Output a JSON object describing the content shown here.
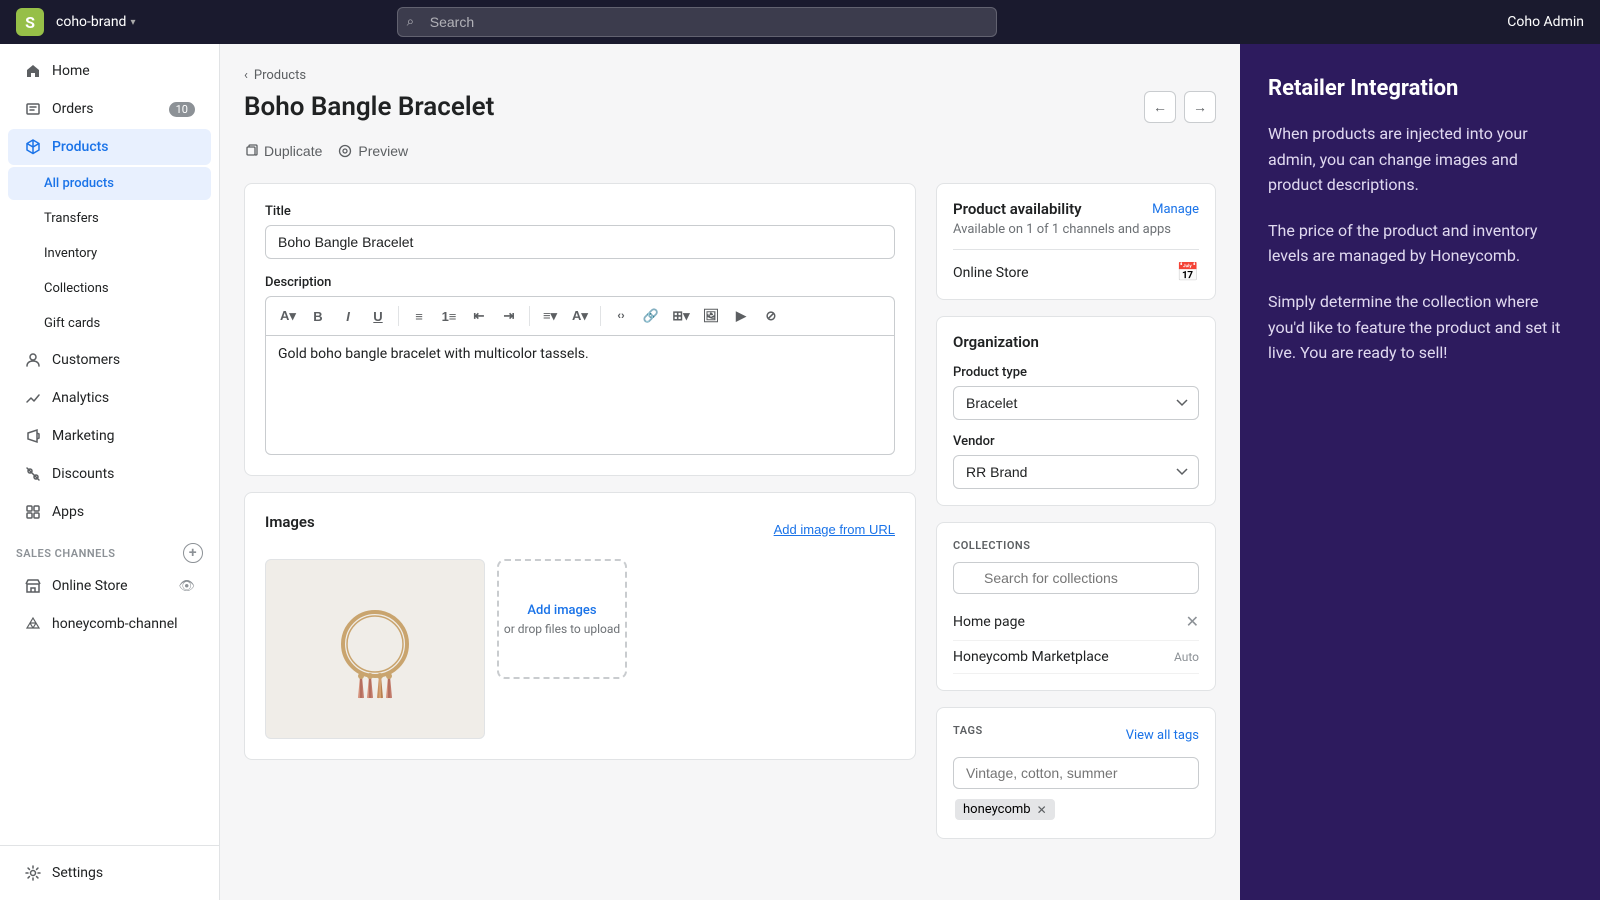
{
  "topnav": {
    "brand": "coho-brand",
    "caret": "▾",
    "search_placeholder": "Search",
    "admin_label": "Coho Admin"
  },
  "sidebar": {
    "items": [
      {
        "id": "home",
        "label": "Home",
        "icon": "home"
      },
      {
        "id": "orders",
        "label": "Orders",
        "icon": "orders",
        "badge": "10"
      },
      {
        "id": "products",
        "label": "Products",
        "icon": "products",
        "active": true
      },
      {
        "id": "all-products",
        "label": "All products",
        "sub": true,
        "active": true
      },
      {
        "id": "transfers",
        "label": "Transfers",
        "sub": true
      },
      {
        "id": "inventory",
        "label": "Inventory",
        "sub": true
      },
      {
        "id": "collections",
        "label": "Collections",
        "sub": true
      },
      {
        "id": "gift-cards",
        "label": "Gift cards",
        "sub": true
      },
      {
        "id": "customers",
        "label": "Customers",
        "icon": "customers"
      },
      {
        "id": "analytics",
        "label": "Analytics",
        "icon": "analytics"
      },
      {
        "id": "marketing",
        "label": "Marketing",
        "icon": "marketing"
      },
      {
        "id": "discounts",
        "label": "Discounts",
        "icon": "discounts"
      },
      {
        "id": "apps",
        "label": "Apps",
        "icon": "apps"
      }
    ],
    "sales_channels_label": "SALES CHANNELS",
    "channels": [
      {
        "id": "online-store",
        "label": "Online Store",
        "icon": "store"
      },
      {
        "id": "honeycomb-channel",
        "label": "honeycomb-channel",
        "icon": "channel"
      }
    ],
    "settings_label": "Settings"
  },
  "breadcrumb": {
    "parent": "Products",
    "chevron": "‹"
  },
  "page": {
    "title": "Boho Bangle Bracelet",
    "actions": {
      "duplicate": "Duplicate",
      "preview": "Preview"
    }
  },
  "product_form": {
    "title_label": "Title",
    "title_value": "Boho Bangle Bracelet",
    "description_label": "Description",
    "description_value": "Gold boho bangle bracelet with multicolor tassels.",
    "images_label": "Images",
    "add_image_url": "Add image from URL",
    "add_images_text": "Add images",
    "drop_text": "or drop files to upload"
  },
  "right_panel": {
    "availability": {
      "title": "Product availability",
      "manage_label": "Manage",
      "sub_text": "Available on 1 of 1 channels and apps",
      "online_store": "Online Store"
    },
    "organization": {
      "title": "Organization",
      "product_type_label": "Product type",
      "product_type_value": "Bracelet",
      "vendor_label": "Vendor",
      "vendor_value": "RR Brand"
    },
    "collections": {
      "section_label": "COLLECTIONS",
      "search_placeholder": "Search for collections",
      "items": [
        {
          "name": "Home page",
          "removable": true
        },
        {
          "name": "Honeycomb Marketplace",
          "auto": "Auto"
        }
      ]
    },
    "tags": {
      "section_label": "TAGS",
      "view_all": "View all tags",
      "placeholder": "Vintage, cotton, summer",
      "chips": [
        "honeycomb"
      ]
    }
  },
  "info_panel": {
    "title": "Retailer Integration",
    "paragraphs": [
      "When products are injected into your admin, you can change images and product descriptions.",
      "The price of the product and inventory levels are managed by Honeycomb.",
      "Simply determine the collection where you'd like to feature the product and set it live. You are ready to sell!"
    ]
  },
  "colors": {
    "topnav_bg": "#1a1a2e",
    "sidebar_active_bg": "#e8f0fe",
    "sidebar_active_text": "#1a73e8",
    "info_panel_bg": "#2d1b5e",
    "link_color": "#1a73e8"
  }
}
